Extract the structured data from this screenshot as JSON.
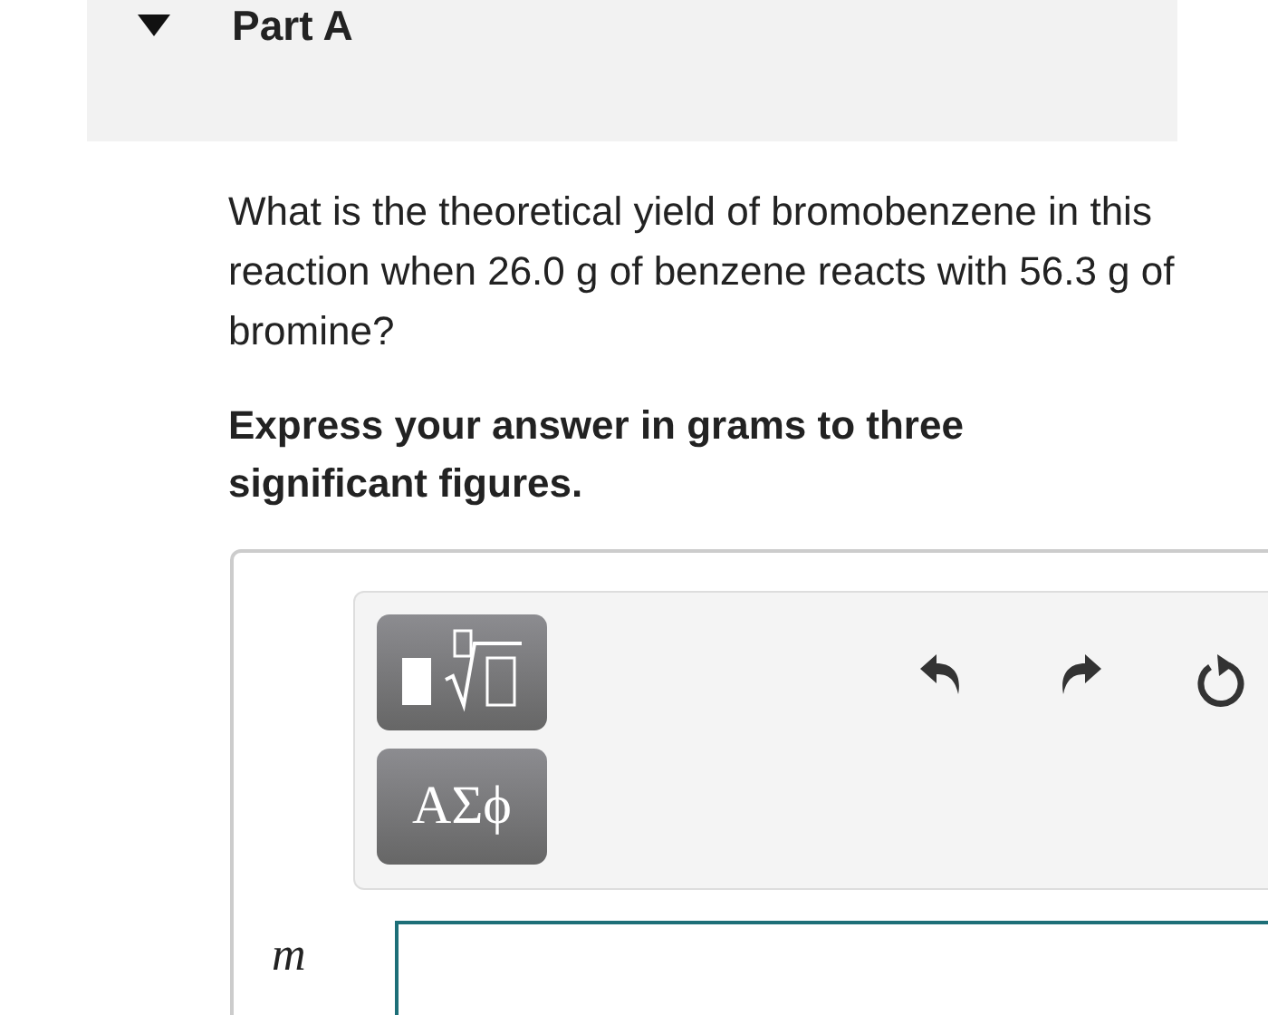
{
  "part": {
    "title": "Part A",
    "expanded": true
  },
  "question": "What is the theoretical yield of bromobenzene in this reaction when 26.0 g of benzene reacts with 56.3 g of bromine?",
  "instruction": "Express your answer in grams to three significant figures.",
  "toolbar": {
    "buttons": [
      {
        "kind": "templates"
      },
      {
        "kind": "greek",
        "label": "ΑΣϕ"
      }
    ],
    "actions": [
      {
        "kind": "undo"
      },
      {
        "kind": "redo"
      },
      {
        "kind": "reset"
      }
    ]
  },
  "answer": {
    "label": "m"
  }
}
